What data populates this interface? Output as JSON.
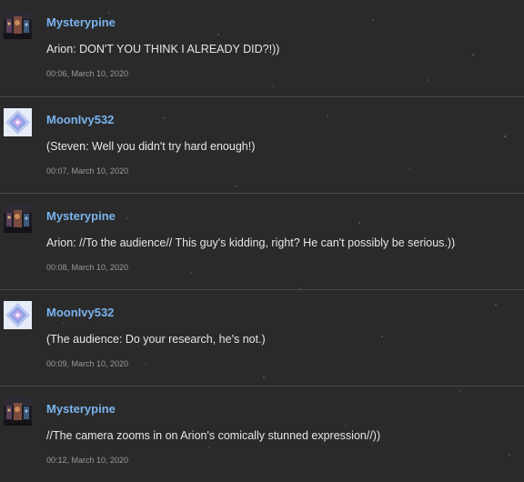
{
  "posts": [
    {
      "username": "Mysterypine",
      "avatar_icon": "mysterypine-avatar-icon",
      "message": "Arion: DON'T YOU THINK I ALREADY DID?!))",
      "timestamp": "00:06, March 10, 2020"
    },
    {
      "username": "MoonIvy532",
      "avatar_icon": "moonivy-avatar-icon",
      "message": "(Steven: Well you didn't try hard enough!)",
      "timestamp": "00:07, March 10, 2020"
    },
    {
      "username": "Mysterypine",
      "avatar_icon": "mysterypine-avatar-icon",
      "message": "Arion: //To the audience// This guy's kidding, right? He can't possibly be serious.))",
      "timestamp": "00:08, March 10, 2020"
    },
    {
      "username": "MoonIvy532",
      "avatar_icon": "moonivy-avatar-icon",
      "message": "(The audience: Do your research, he's not.)",
      "timestamp": "00:09, March 10, 2020"
    },
    {
      "username": "Mysterypine",
      "avatar_icon": "mysterypine-avatar-icon",
      "message": "//The camera zooms in on Arion's comically stunned expression//))",
      "timestamp": "00:12, March 10, 2020"
    }
  ],
  "colors": {
    "background": "#2a2a2a",
    "username": "#7ab3ef",
    "message": "#e6e6e6",
    "timestamp": "#9a9a9a",
    "divider": "#4a4a4a"
  }
}
